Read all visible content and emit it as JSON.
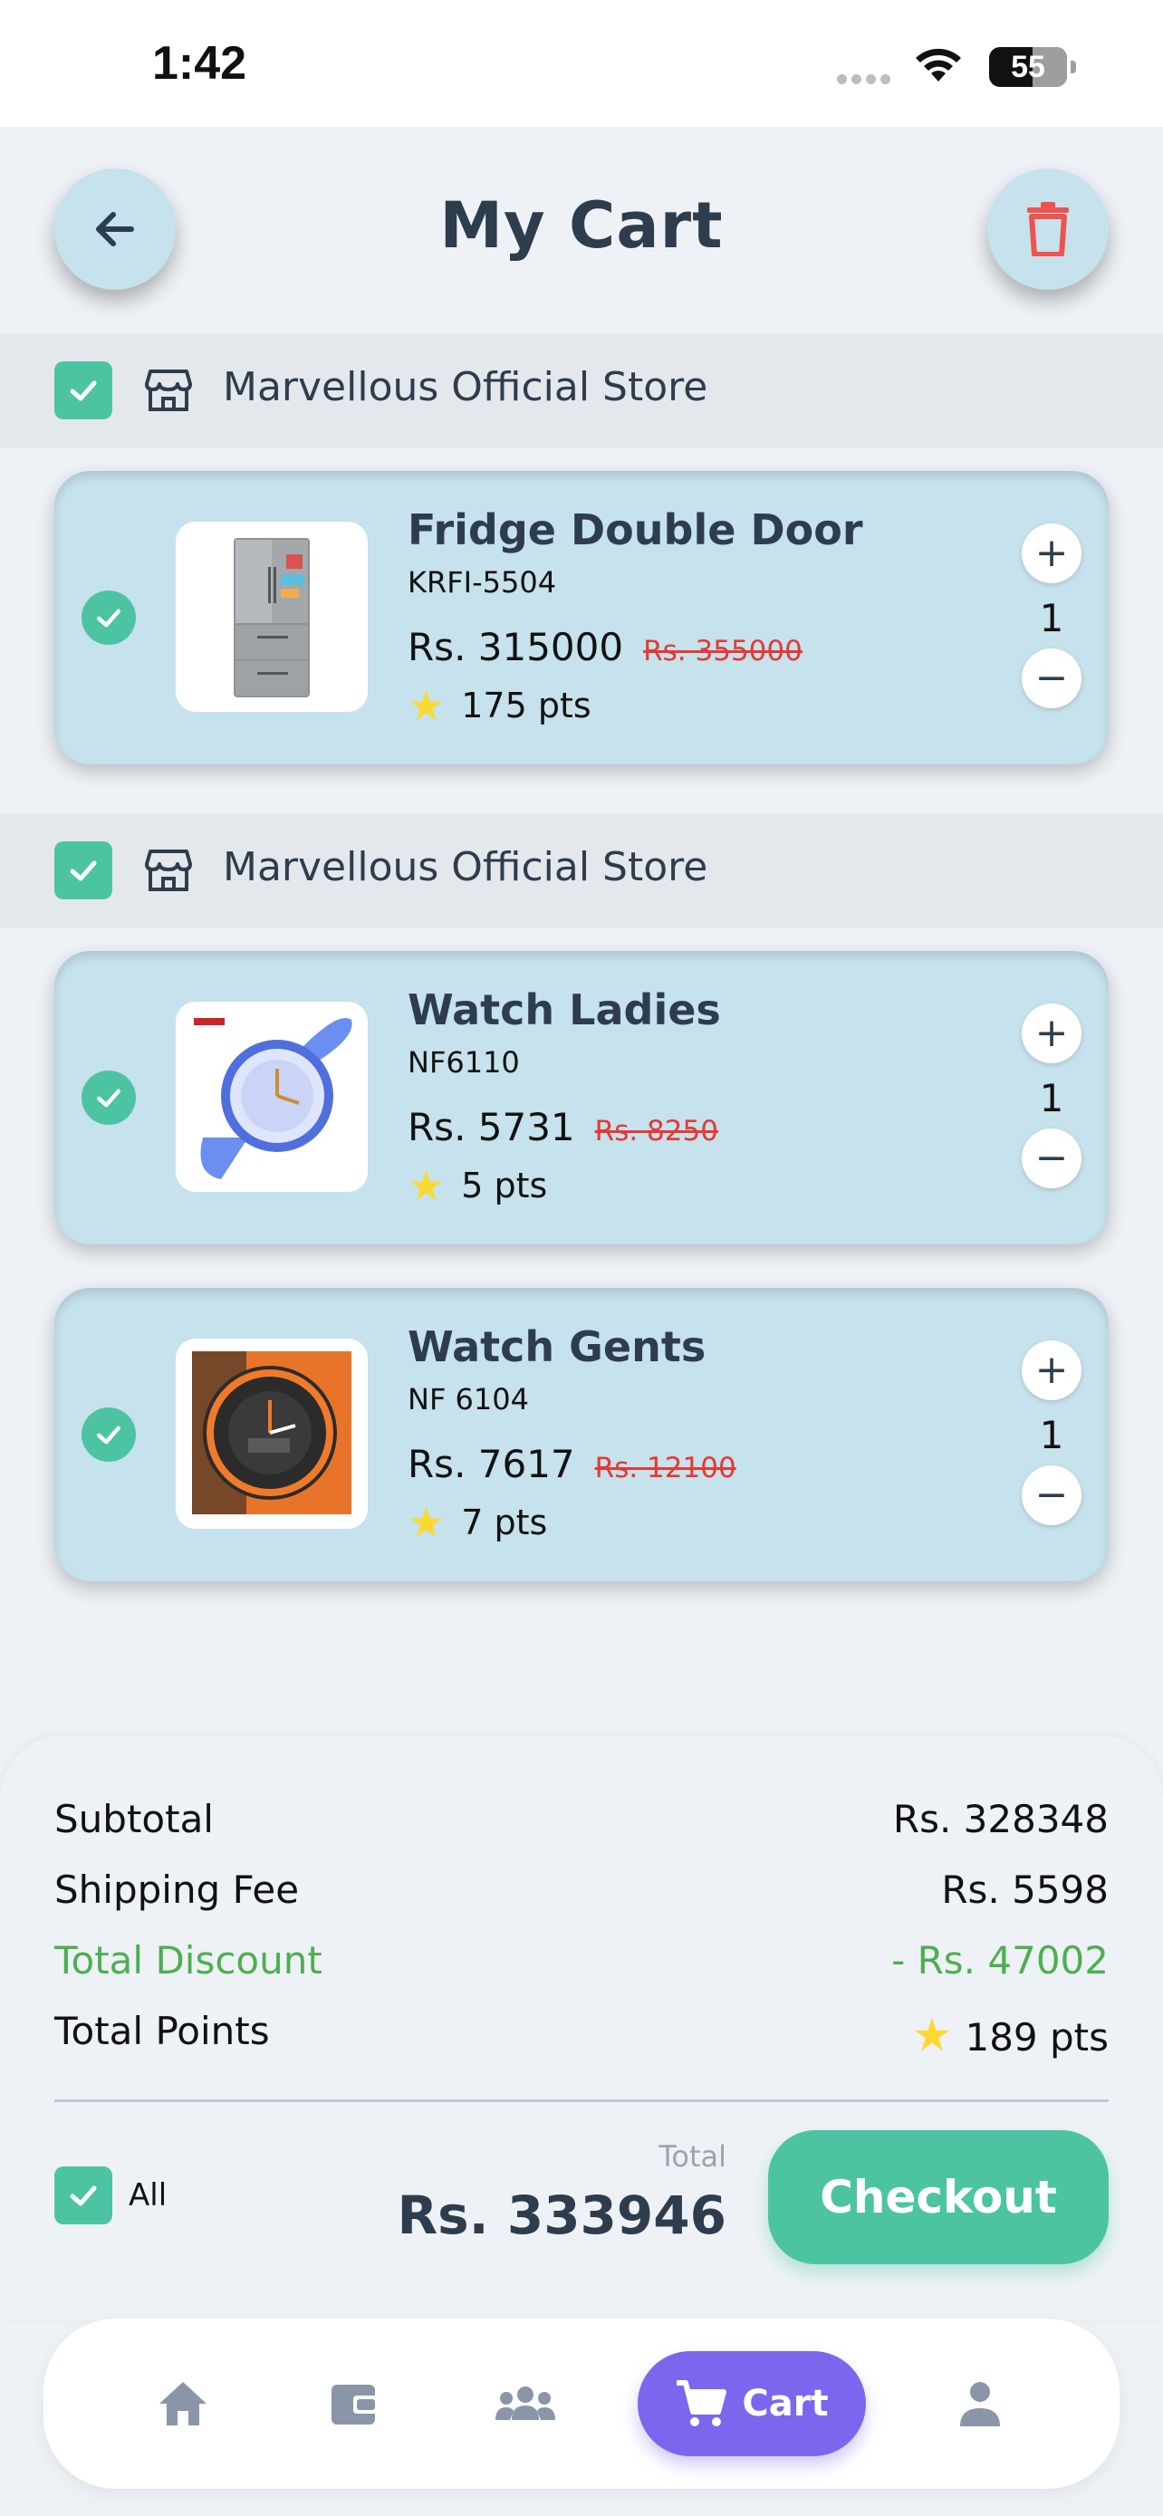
{
  "status_bar": {
    "time": "1:42",
    "battery": "55"
  },
  "header": {
    "title": "My Cart",
    "back_icon": "arrow-left-icon",
    "delete_icon": "trash-icon"
  },
  "stores": [
    {
      "name": "Marvellous Official Store",
      "items": [
        {
          "name": "Fridge Double Door",
          "sku": "KRFI-5504",
          "price": "Rs. 315000",
          "old_price": "Rs. 355000",
          "points": "175 pts",
          "qty": "1",
          "image": "fridge"
        }
      ]
    },
    {
      "name": "Marvellous Official Store",
      "items": [
        {
          "name": "Watch Ladies",
          "sku": "NF6110",
          "price": "Rs. 5731",
          "old_price": "Rs. 8250",
          "points": "5 pts",
          "qty": "1",
          "image": "watch-ladies"
        },
        {
          "name": "Watch Gents",
          "sku": "NF 6104",
          "price": "Rs. 7617",
          "old_price": "Rs. 12100",
          "points": "7 pts",
          "qty": "1",
          "image": "watch-gents"
        }
      ]
    }
  ],
  "summary": {
    "subtotal_label": "Subtotal",
    "subtotal": "Rs. 328348",
    "shipping_label": "Shipping Fee",
    "shipping": "Rs. 5598",
    "discount_label": "Total Discount",
    "discount": "- Rs. 47002",
    "points_label": "Total Points",
    "points": "189 pts"
  },
  "footer": {
    "all_label": "All",
    "total_label": "Total",
    "total": "Rs. 333946",
    "checkout_label": "Checkout"
  },
  "nav": {
    "items": [
      "home-icon",
      "wallet-icon",
      "group-icon",
      "cart-icon",
      "person-icon"
    ],
    "active_label": "Cart"
  },
  "colors": {
    "accent": "#4cc4a2",
    "card": "#c6e2ec",
    "nav_active": "#7b66ee",
    "discount": "#4caf50",
    "old_price": "#e53935"
  }
}
